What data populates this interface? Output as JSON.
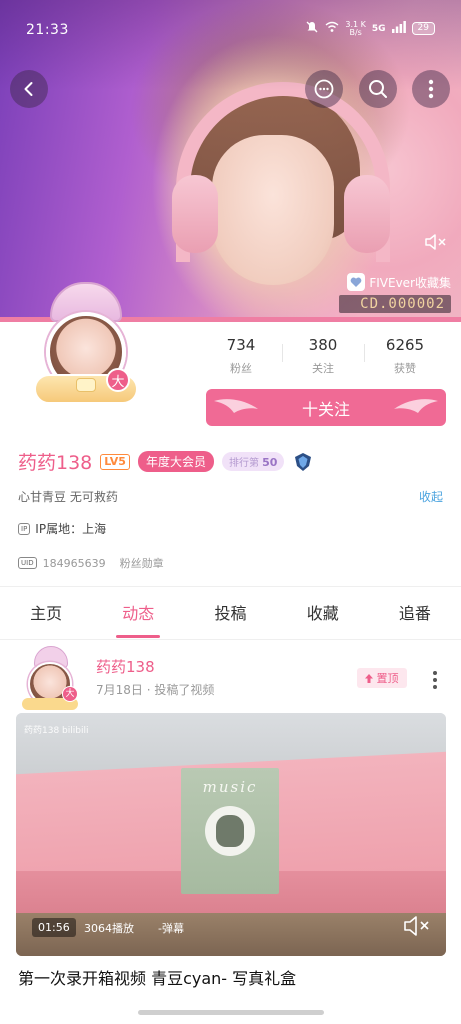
{
  "status": {
    "time": "21:33",
    "net_top": "3.1 K",
    "net_bottom": "B/s",
    "signal": "5G",
    "battery": "29"
  },
  "header": {
    "collection_label": "FIVEver收藏集",
    "collection_code": "CD.000002"
  },
  "profile": {
    "avatar_level": "大",
    "stats": [
      {
        "value": "734",
        "label": "粉丝"
      },
      {
        "value": "380",
        "label": "关注"
      },
      {
        "value": "6265",
        "label": "获赞"
      }
    ],
    "follow_label": "十关注",
    "name": "药药138",
    "level": "LV5",
    "vip": "年度大会员",
    "rank_prefix": "排行第",
    "rank_value": "50",
    "bio": "心甘青豆 无可救药",
    "collapse": "收起",
    "ip_tag": "IP",
    "ip_location": "IP属地：上海",
    "uid_tag": "UID",
    "uid": "184965639",
    "fan_medal": "粉丝勋章"
  },
  "tabs": [
    {
      "label": "主页",
      "active": false
    },
    {
      "label": "动态",
      "active": true
    },
    {
      "label": "投稿",
      "active": false
    },
    {
      "label": "收藏",
      "active": false
    },
    {
      "label": "追番",
      "active": false
    }
  ],
  "post": {
    "author": "药药138",
    "avatar_level": "大",
    "meta": "7月18日 · 投稿了视频",
    "pinned": "置顶",
    "video": {
      "watermark": "药药138 bilibili",
      "box_text": "music",
      "duration": "01:56",
      "plays": "3064播放",
      "danmaku": "-弹幕"
    },
    "title": "第一次录开箱视频 青豆cyan- 写真礼盒"
  },
  "colors": {
    "accent": "#ee5e8a",
    "follow_button": "#f06a95",
    "link": "#4aa3df",
    "level": "#ff8a3c"
  }
}
